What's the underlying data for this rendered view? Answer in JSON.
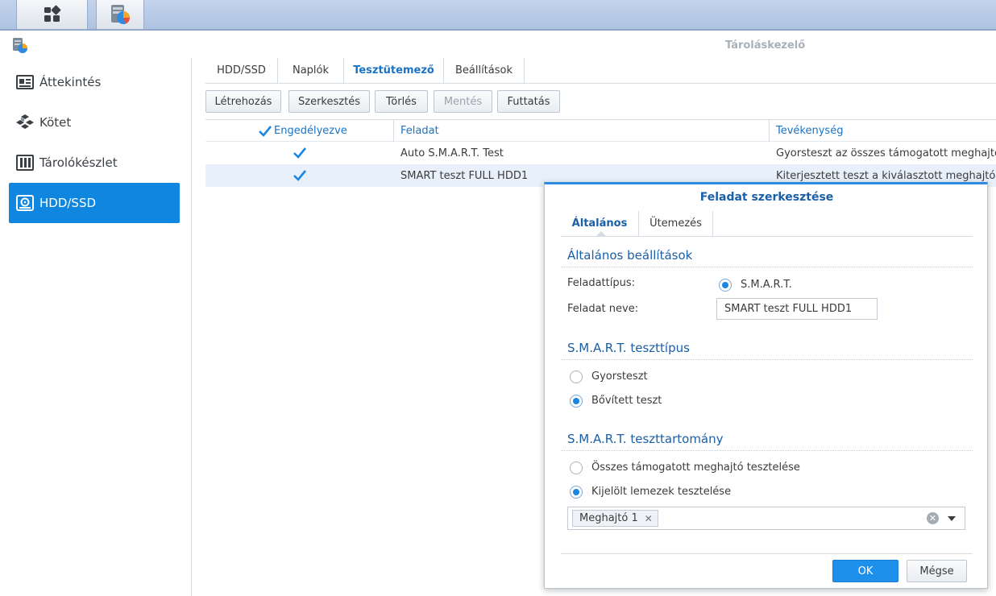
{
  "app": {
    "title": "Tároláskezelő"
  },
  "colors": {
    "accent": "#0f86e0",
    "link": "#1a73c4",
    "selected_row": "#e8f1fb"
  },
  "sidebar": {
    "items": [
      {
        "label": "Áttekintés",
        "icon": "overview-icon"
      },
      {
        "label": "Kötet",
        "icon": "volume-icon"
      },
      {
        "label": "Tárolókészlet",
        "icon": "storage-pool-icon"
      },
      {
        "label": "HDD/SSD",
        "icon": "hdd-icon",
        "active": true
      }
    ]
  },
  "tabs": [
    {
      "label": "HDD/SSD"
    },
    {
      "label": "Naplók"
    },
    {
      "label": "Tesztütemező",
      "active": true
    },
    {
      "label": "Beállítások"
    }
  ],
  "toolbar": {
    "create": "Létrehozás",
    "edit": "Szerkesztés",
    "delete": "Törlés",
    "save": "Mentés",
    "run": "Futtatás"
  },
  "grid": {
    "columns": {
      "enabled": "Engedélyezve",
      "task": "Feladat",
      "action": "Tevékenység"
    },
    "rows": [
      {
        "enabled": true,
        "task": "Auto S.M.A.R.T. Test",
        "action": "Gyorsteszt az összes támogatott meghajtón"
      },
      {
        "enabled": true,
        "task": "SMART teszt FULL HDD1",
        "action": "Kiterjesztett teszt a kiválasztott meghajtókon"
      }
    ]
  },
  "dialog": {
    "title": "Feladat szerkesztése",
    "tabs": [
      {
        "label": "Általános",
        "active": true
      },
      {
        "label": "Ütemezés"
      }
    ],
    "general": {
      "section_title": "Általános beállítások",
      "task_type_label": "Feladattípus:",
      "task_type_value": "S.M.A.R.T.",
      "task_name_label": "Feladat neve:",
      "task_name_value": "SMART teszt FULL HDD1"
    },
    "test_type": {
      "section_title": "S.M.A.R.T. teszttípus",
      "options": [
        {
          "label": "Gyorsteszt",
          "selected": false
        },
        {
          "label": "Bővített teszt",
          "selected": true
        }
      ]
    },
    "test_range": {
      "section_title": "S.M.A.R.T. teszttartomány",
      "options": [
        {
          "label": "Összes támogatott meghajtó tesztelése",
          "selected": false
        },
        {
          "label": "Kijelölt lemezek tesztelése",
          "selected": true
        }
      ],
      "selected_disks": [
        "Meghajtó 1"
      ]
    },
    "ok": "OK",
    "cancel": "Mégse"
  }
}
